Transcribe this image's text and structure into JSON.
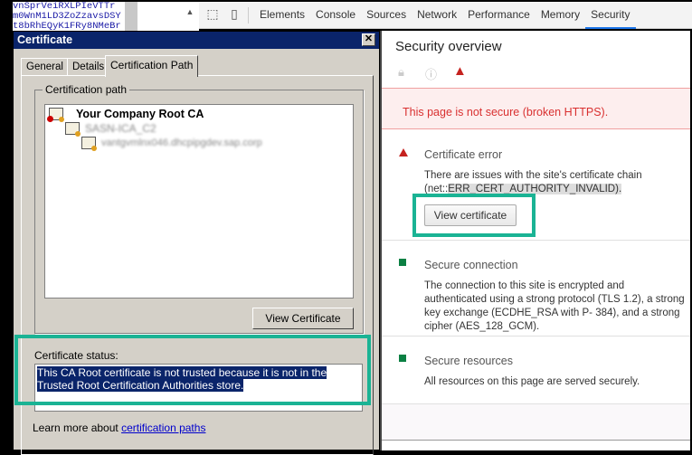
{
  "code_strip": {
    "lines": [
      "vnSprVeiRXLPIeVTTr",
      "m0WnM1LD3ZoZzavsDSY",
      "t8bRhEQyK1FRy8NMeBr"
    ]
  },
  "devtools": {
    "tabs": [
      "Elements",
      "Console",
      "Sources",
      "Network",
      "Performance",
      "Memory",
      "Security"
    ],
    "active_tab": "Security",
    "icons": [
      "inspect-element-icon",
      "device-toolbar-icon"
    ]
  },
  "dialog": {
    "title": "Certificate",
    "tabs": [
      "General",
      "Details",
      "Certification Path"
    ],
    "active_tab": "Certification Path",
    "group_label": "Certification path",
    "tree": [
      {
        "label": "Your Company Root CA",
        "status": "error"
      },
      {
        "label": "SASN-ICA_C2",
        "blurred": true
      },
      {
        "label": "vantgvmlnx046.dhcpipgdev.sap.corp",
        "blurred": true
      }
    ],
    "view_certificate_label": "View Certificate",
    "status_label": "Certificate status:",
    "status_text": "This CA Root certificate is not trusted because it is not in the Trusted Root Certification Authorities store.",
    "learn_prefix": "Learn more about ",
    "learn_link": "certification paths"
  },
  "security": {
    "title": "Security overview",
    "banner": "This page is not secure (broken HTTPS).",
    "sections": [
      {
        "title": "Certificate error",
        "desc1": "There are issues with the site's certificate chain",
        "desc2_prefix": "(net::",
        "desc2_code": "ERR_CERT_AUTHORITY_INVALID).",
        "button": "View certificate",
        "color": "#c5221f"
      },
      {
        "title": "Secure connection",
        "lines": [
          "The connection to this site is encrypted and authenticated using a",
          "strong protocol (TLS 1.2), a strong key exchange (ECDHE_RSA with P-",
          "384), and a strong cipher (AES_128_GCM)."
        ],
        "color": "#0b8043"
      },
      {
        "title": "Secure resources",
        "lines": [
          "All resources on this page are served securely."
        ],
        "color": "#0b8043"
      }
    ]
  },
  "colors": {
    "highlight": "#1ab394",
    "titlebar": "#0a246a",
    "error": "#d93030"
  }
}
